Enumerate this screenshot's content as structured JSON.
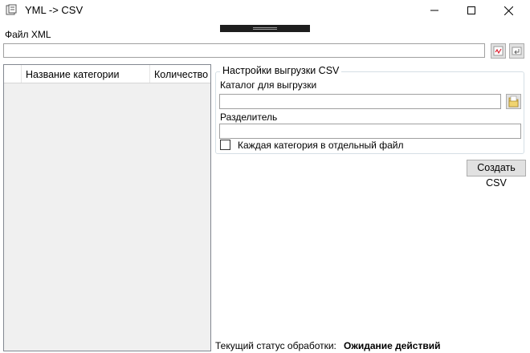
{
  "window": {
    "title": "YML -> CSV",
    "minimize_label": "minimize",
    "maximize_label": "maximize",
    "close_label": "close"
  },
  "xml_file": {
    "label": "Файл XML",
    "value": "",
    "validate_icon": "validate-icon",
    "enter_icon": "enter-icon"
  },
  "grid": {
    "columns": [
      "Название категории",
      "Количество"
    ],
    "rows": []
  },
  "settings": {
    "legend": "Настройки выгрузки CSV",
    "dir_label": "Каталог для выгрузки",
    "dir_value": "",
    "browse_icon": "folder-icon",
    "separator_label": "Разделитель",
    "separator_value": "",
    "per_category_label": "Каждая категория в отдельный файл",
    "per_category_checked": false
  },
  "create_button": "Создать CSV",
  "status": {
    "label": "Текущий статус обработки:",
    "value": "Ожидание действий"
  },
  "colors": {
    "grid_bg": "#f0f0f0",
    "button_bg": "#e1e1e1",
    "border": "#a0a0a0"
  }
}
